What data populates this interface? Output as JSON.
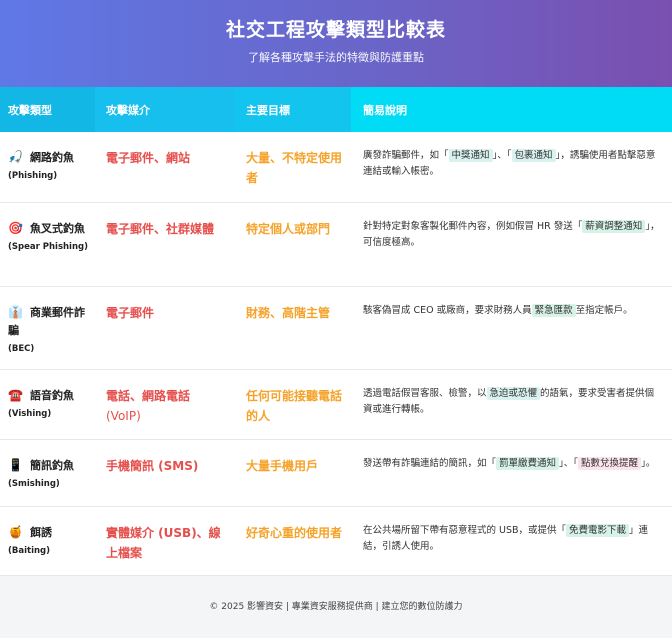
{
  "header": {
    "title": "社交工程攻擊類型比較表",
    "subtitle": "了解各種攻擊手法的特徵與防護重點"
  },
  "columns": [
    "攻擊類型",
    "攻擊媒介",
    "主要目標",
    "簡易說明"
  ],
  "rows": [
    {
      "icon": "🎣",
      "name": "網路釣魚",
      "en": "(Phishing)",
      "media": "電子郵件、網站",
      "target": "大量、不特定使用者",
      "desc": {
        "p1": "廣發詐騙郵件，如「",
        "h1": "中獎通知",
        "p2": "」、「",
        "h2": "包裹通知",
        "p3": "」，誘騙使用者點擊惡意連結或輸入帳密。"
      }
    },
    {
      "icon": "🎯",
      "name": "魚叉式釣魚",
      "en": "(Spear Phishing)",
      "media": "電子郵件、社群媒體",
      "target": "特定個人或部門",
      "desc": {
        "p1": "針對特定對象客製化郵件內容，例如假冒 HR 發送「",
        "h1": "薪資調整通知",
        "p2": "」，可信度極高。"
      }
    },
    {
      "icon": "👔",
      "name": "商業郵件詐騙",
      "en": "(BEC)",
      "media": "電子郵件",
      "target": "財務、高階主管",
      "desc": {
        "p1": "駭客偽冒成 CEO 或廠商，要求財務人員",
        "h1": "緊急匯款",
        "p2": "至指定帳戶。"
      }
    },
    {
      "icon": "☎️",
      "name": "語音釣魚",
      "en": "(Vishing)",
      "media_main": "電話、網路電話",
      "media_sub": "(VoIP)",
      "target": "任何可能接聽電話的人",
      "desc": {
        "p1": "透過電話假冒客服、檢警，以",
        "h1": "急迫或恐懼",
        "p2": "的語氣，要求受害者提供個資或進行轉帳。"
      }
    },
    {
      "icon": "📱",
      "name": "簡訊釣魚",
      "en": "(Smishing)",
      "media": "手機簡訊 (SMS)",
      "target": "大量手機用戶",
      "desc": {
        "p1": "發送帶有詐騙連結的簡訊，如「",
        "h1": "罰單繳費通知",
        "p2": "」、「",
        "h2": "點數兌換提醒",
        "p3": "」。"
      }
    },
    {
      "icon": "🍯",
      "name": "餌誘",
      "en": "(Baiting)",
      "media": "實體媒介 (USB)、線上檔案",
      "target": "好奇心重的使用者",
      "desc": {
        "p1": "在公共場所留下帶有惡意程式的 USB，或提供「",
        "h1": "免費電影下載",
        "p2": "」連結，引誘人使用。"
      }
    }
  ],
  "footer": "© 2025 影響資安 | 專業資安服務提供商 | 建立您的數位防護力",
  "colors": {
    "header_gradient": [
      "#5f78e6",
      "#7a4fb0"
    ],
    "table_header": "#12b7e6",
    "media_text": "#e5504d",
    "target_text": "#f5a32a"
  }
}
